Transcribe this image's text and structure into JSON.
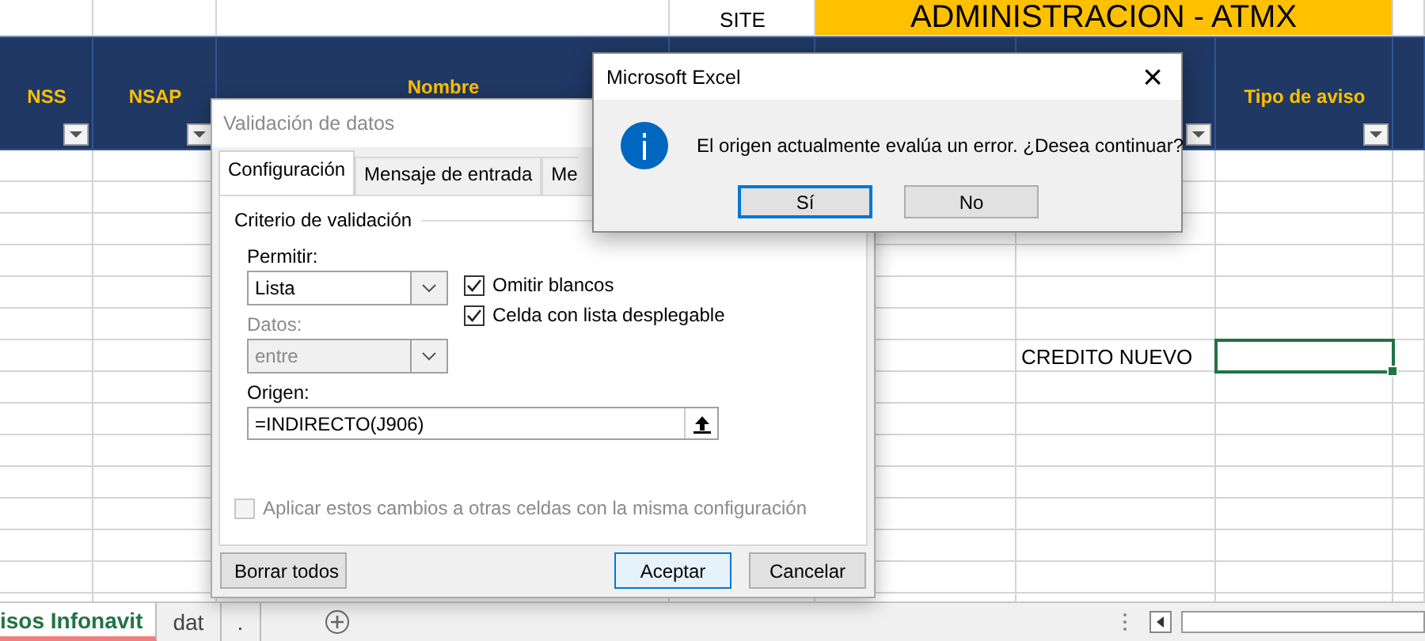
{
  "sheet": {
    "site": "SITE",
    "banner": "ADMINISTRACION - ATMX",
    "columns": [
      {
        "header": "NSS",
        "filter": true
      },
      {
        "header": "NSAP",
        "filter": true
      },
      {
        "header": "Nombre"
      },
      {},
      {},
      {
        "filter": true
      },
      {
        "header": "Tipo de aviso",
        "filter": true
      },
      {}
    ],
    "entry_row": [
      {
        "value": "CREDITO NUEVO",
        "selected": false
      },
      {
        "selected": true
      }
    ]
  },
  "validation_dialog": {
    "title": "Validación de datos",
    "tabs": [
      {
        "label": "Configuración",
        "selected": true
      },
      {
        "label": "Mensaje de entrada",
        "selected": false
      },
      {
        "label": "Me",
        "selected": false
      }
    ],
    "group_label": "Criterio de validación",
    "allow_label": "Permitir:",
    "allow_value": "Lista",
    "data_label": "Datos:",
    "data_value": "entre",
    "data_disabled": true,
    "checkboxes": [
      {
        "label": "Omitir blancos",
        "checked": true
      },
      {
        "label": "Celda con lista desplegable",
        "checked": true
      }
    ],
    "source_label": "Origen:",
    "source_value": "=INDIRECTO(J906)",
    "apply_all": {
      "label": "Aplicar estos cambios a otras celdas con la misma configuración",
      "checked": false,
      "disabled": true
    },
    "buttons": [
      {
        "label": "Borrar todos",
        "default": false
      },
      {
        "label": "Aceptar",
        "default": true
      },
      {
        "label": "Cancelar",
        "default": false
      }
    ]
  },
  "message_box": {
    "title": "Microsoft Excel",
    "close": "×",
    "message": "El origen actualmente evalúa un error. ¿Desea continuar?",
    "buttons": [
      {
        "label": "Sí",
        "default": true
      },
      {
        "label": "No",
        "default": false
      }
    ]
  },
  "sheet_tabs": [
    {
      "label": "isos Infonavit",
      "selected": true
    },
    {
      "label": "dat",
      "selected": false
    },
    {
      "label": ".",
      "selected": false
    }
  ]
}
